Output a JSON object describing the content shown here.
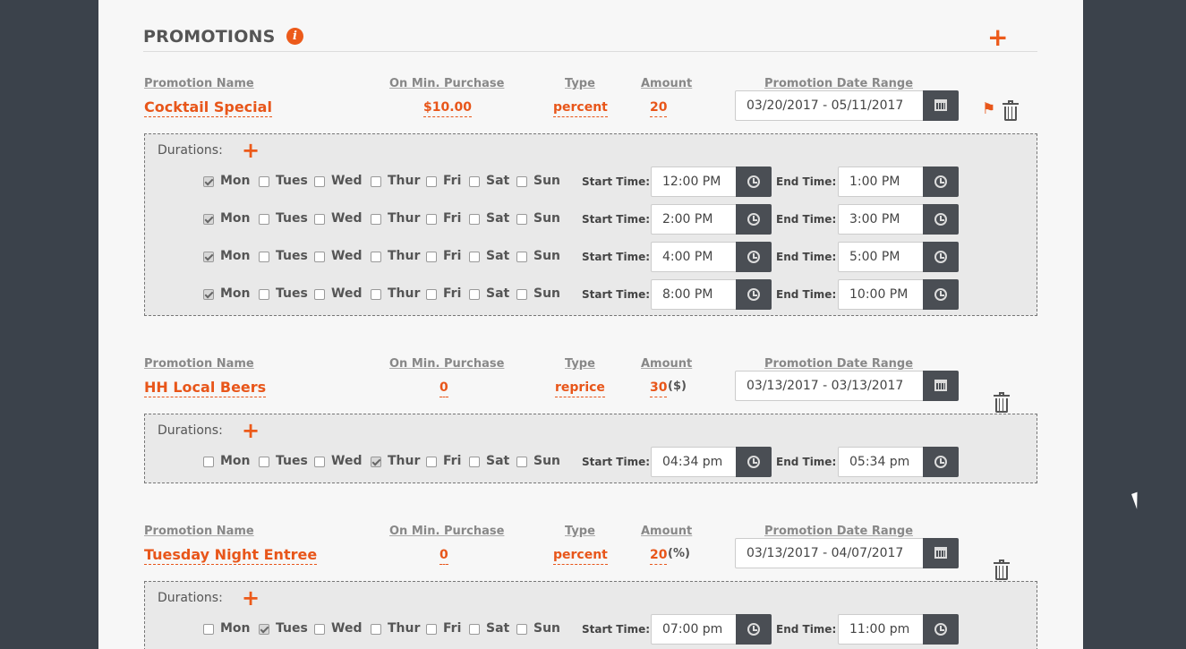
{
  "header": {
    "title": "PROMOTIONS",
    "info_icon": "info-icon",
    "add_icon": "plus-icon"
  },
  "columns": {
    "name": "Promotion Name",
    "min_purchase": "On Min. Purchase",
    "type": "Type",
    "amount": "Amount",
    "date_range": "Promotion Date Range"
  },
  "labels": {
    "durations": "Durations:",
    "start_time": "Start Time:",
    "end_time": "End Time:"
  },
  "days": [
    "Mon",
    "Tues",
    "Wed",
    "Thur",
    "Fri",
    "Sat",
    "Sun"
  ],
  "colors": {
    "accent": "#e8561a",
    "background": "#3b424b",
    "panel": "#f7f7f7"
  },
  "promotions": [
    {
      "name": "Cocktail Special",
      "min_purchase": "$10.00",
      "type": "percent",
      "amount": "20",
      "amount_unit": "",
      "date_range": "03/20/2017 - 05/11/2017",
      "durations": [
        {
          "checked": [
            true,
            false,
            false,
            false,
            false,
            false,
            false
          ],
          "start": "12:00 PM",
          "end": "1:00 PM"
        },
        {
          "checked": [
            true,
            false,
            false,
            false,
            false,
            false,
            false
          ],
          "start": "2:00 PM",
          "end": "3:00 PM"
        },
        {
          "checked": [
            true,
            false,
            false,
            false,
            false,
            false,
            false
          ],
          "start": "4:00 PM",
          "end": "5:00 PM"
        },
        {
          "checked": [
            true,
            false,
            false,
            false,
            false,
            false,
            false
          ],
          "start": "8:00 PM",
          "end": "10:00 PM"
        }
      ]
    },
    {
      "name": "HH Local Beers",
      "min_purchase": "0",
      "type": "reprice",
      "amount": "30",
      "amount_unit": "($)",
      "date_range": "03/13/2017 - 03/13/2017",
      "durations": [
        {
          "checked": [
            false,
            false,
            false,
            true,
            false,
            false,
            false
          ],
          "start": "04:34 pm",
          "end": "05:34 pm"
        }
      ]
    },
    {
      "name": "Tuesday Night Entree",
      "min_purchase": "0",
      "type": "percent",
      "amount": "20",
      "amount_unit": "(%)",
      "date_range": "03/13/2017 - 04/07/2017",
      "durations": [
        {
          "checked": [
            false,
            true,
            false,
            false,
            false,
            false,
            false
          ],
          "start": "07:00 pm",
          "end": "11:00 pm"
        }
      ]
    }
  ]
}
